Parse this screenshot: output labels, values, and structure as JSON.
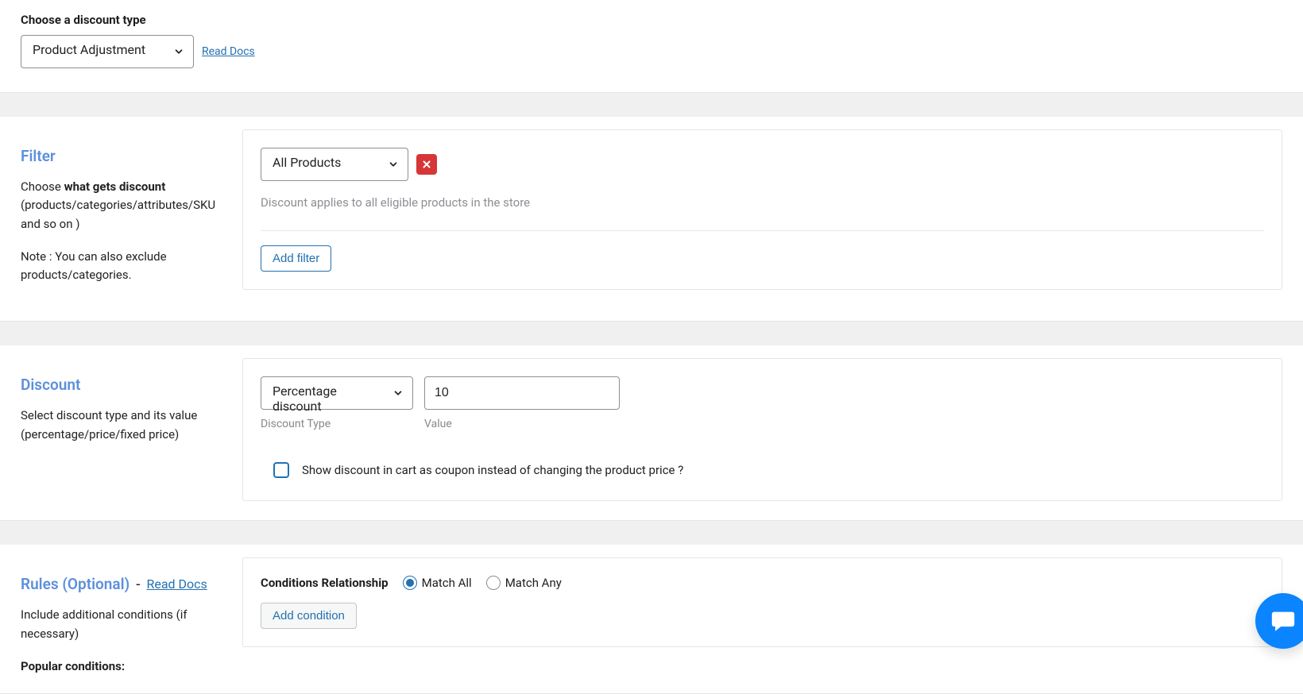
{
  "discountType": {
    "label": "Choose a discount type",
    "value": "Product Adjustment",
    "docsLabel": "Read Docs"
  },
  "filter": {
    "title": "Filter",
    "desc_pre": "Choose ",
    "desc_strong": "what gets discount",
    "desc_post": " (products/categories/attributes/SKU and so on )",
    "note": "Note : You can also exclude products/categories.",
    "selectValue": "All Products",
    "hint": "Discount applies to all eligible products in the store",
    "addFilterLabel": "Add filter"
  },
  "discount": {
    "title": "Discount",
    "desc": "Select discount type and its value (percentage/price/fixed price)",
    "typeValue": "Percentage discount",
    "valueValue": "10",
    "typeLabel": "Discount Type",
    "valueLabel": "Value",
    "cbLabel": "Show discount in cart as coupon instead of changing the product price ?"
  },
  "rules": {
    "title": "Rules (Optional)",
    "docsLabel": "Read Docs",
    "desc": "Include additional conditions (if necessary)",
    "popular": "Popular conditions:",
    "condLabel": "Conditions Relationship",
    "matchAll": "Match All",
    "matchAny": "Match Any",
    "addConditionLabel": "Add condition"
  }
}
